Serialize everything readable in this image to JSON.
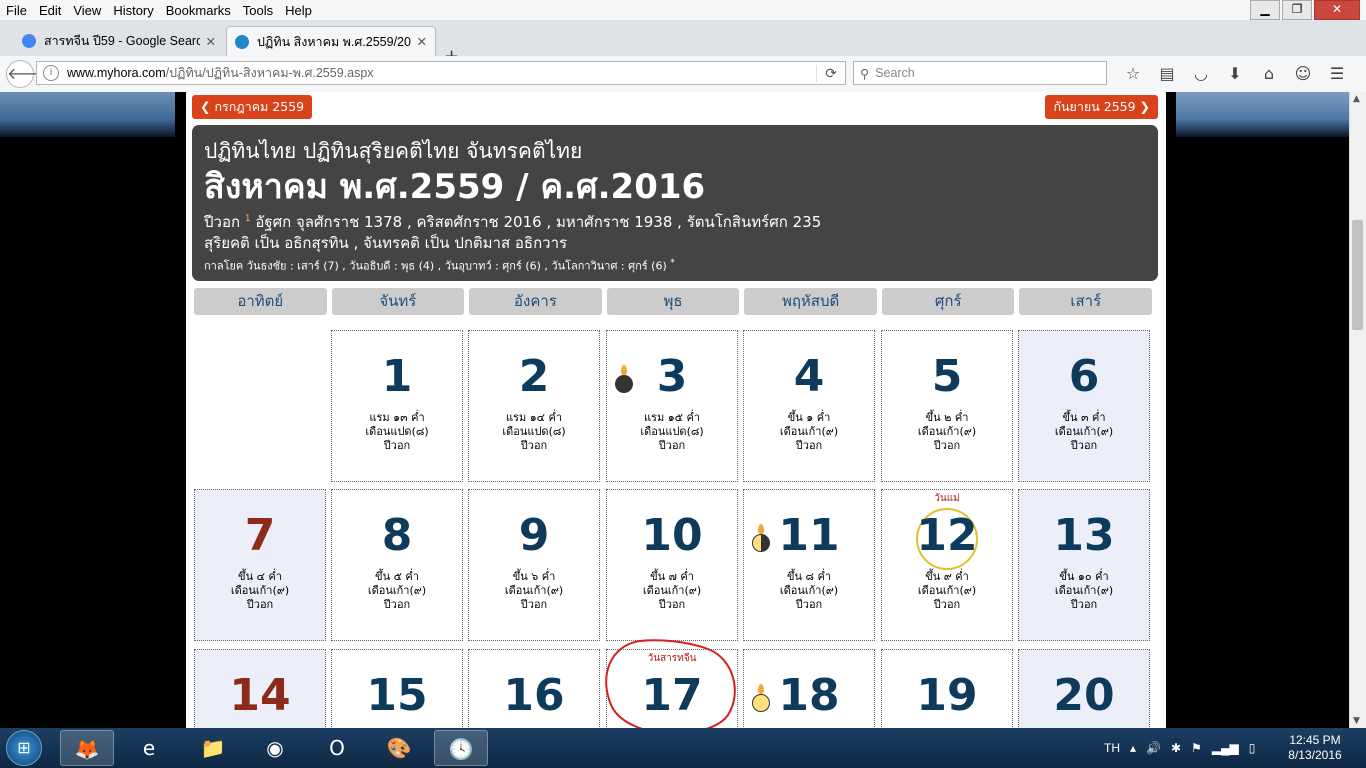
{
  "menubar": {
    "items": [
      "File",
      "Edit",
      "View",
      "History",
      "Bookmarks",
      "Tools",
      "Help"
    ]
  },
  "window": {
    "min": "▁",
    "max": "❐",
    "close": "✕"
  },
  "tabs": [
    {
      "title": "สารทจีน ปี59 - Google Search",
      "color": "#4285f4"
    },
    {
      "title": "ปฏิทิน สิงหาคม พ.ศ.2559/20...",
      "color": "#1e88c8"
    }
  ],
  "new_tab": "+",
  "nav": {
    "url_host": "www.myhora.com",
    "url_path": "/ปฏิทิน/ปฏิทิน-สิงหาคม-พ.ศ.2559.aspx",
    "search_placeholder": "Search"
  },
  "calendar": {
    "prev_month": "❮ กรกฎาคม 2559",
    "next_month": "กันยายน 2559 ❯",
    "title": "ปฏิทินไทย ปฏิทินสุริยคติไทย จันทรคติไทย",
    "month_year": "สิงหาคม พ.ศ.2559 / ค.ศ.2016",
    "era_prefix": "ปีวอก",
    "era_sup": "1",
    "era_text": "อัฐศก จุลศักราช 1378 , คริสตศักราช 2016 , มหาศักราช 1938 , รัตนโกสินทร์ศก 235",
    "solar_lunar": "สุริยคติ เป็น อธิกสุรทิน , จันทรคติ เป็น ปกติมาส อธิกวาร",
    "kala": "กาลโยค วันธงชัย : เสาร์ (7) , วันอธิบดี : พุธ (4) , วันอุบาทว์ : ศุกร์ (6) , วันโลกาวินาศ : ศุกร์ (6)",
    "kala_mark": "*",
    "weekdays": [
      "อาทิตย์",
      "จันทร์",
      "อังคาร",
      "พุธ",
      "พฤหัสบดี",
      "ศุกร์",
      "เสาร์"
    ],
    "days": [
      {
        "day": "1",
        "lunar1": "แรม ๑๓ ค่ำ",
        "lunar2": "เดือนแปด(๘)",
        "lunar3": "ปีวอก"
      },
      {
        "day": "2",
        "lunar1": "แรม ๑๔ ค่ำ",
        "lunar2": "เดือนแปด(๘)",
        "lunar3": "ปีวอก"
      },
      {
        "day": "3",
        "lunar1": "แรม ๑๕ ค่ำ",
        "lunar2": "เดือนแปด(๘)",
        "lunar3": "ปีวอก",
        "moon": "new"
      },
      {
        "day": "4",
        "lunar1": "ขึ้น ๑ ค่ำ",
        "lunar2": "เดือนเก้า(๙)",
        "lunar3": "ปีวอก"
      },
      {
        "day": "5",
        "lunar1": "ขึ้น ๒ ค่ำ",
        "lunar2": "เดือนเก้า(๙)",
        "lunar3": "ปีวอก"
      },
      {
        "day": "6",
        "lunar1": "ขึ้น ๓ ค่ำ",
        "lunar2": "เดือนเก้า(๙)",
        "lunar3": "ปีวอก"
      },
      {
        "day": "7",
        "lunar1": "ขึ้น ๔ ค่ำ",
        "lunar2": "เดือนเก้า(๙)",
        "lunar3": "ปีวอก"
      },
      {
        "day": "8",
        "lunar1": "ขึ้น ๕ ค่ำ",
        "lunar2": "เดือนเก้า(๙)",
        "lunar3": "ปีวอก"
      },
      {
        "day": "9",
        "lunar1": "ขึ้น ๖ ค่ำ",
        "lunar2": "เดือนเก้า(๙)",
        "lunar3": "ปีวอก"
      },
      {
        "day": "10",
        "lunar1": "ขึ้น ๗ ค่ำ",
        "lunar2": "เดือนเก้า(๙)",
        "lunar3": "ปีวอก"
      },
      {
        "day": "11",
        "lunar1": "ขึ้น ๘ ค่ำ",
        "lunar2": "เดือนเก้า(๙)",
        "lunar3": "ปีวอก",
        "moon": "half"
      },
      {
        "day": "12",
        "lunar1": "ขึ้น ๙ ค่ำ",
        "lunar2": "เดือนเก้า(๙)",
        "lunar3": "ปีวอก",
        "note": "วันแม่",
        "today": true
      },
      {
        "day": "13",
        "lunar1": "ขึ้น ๑๐ ค่ำ",
        "lunar2": "เดือนเก้า(๙)",
        "lunar3": "ปีวอก"
      },
      {
        "day": "14"
      },
      {
        "day": "15"
      },
      {
        "day": "16"
      },
      {
        "day": "17",
        "note": "วันสารทจีน"
      },
      {
        "day": "18",
        "moon": "full"
      },
      {
        "day": "19"
      },
      {
        "day": "20"
      }
    ]
  },
  "taskbar": {
    "items": [
      {
        "icon": "firefox-icon",
        "glyph": "🦊",
        "active": true
      },
      {
        "icon": "ie-icon",
        "glyph": "e"
      },
      {
        "icon": "explorer-icon",
        "glyph": "📁"
      },
      {
        "icon": "chrome-icon",
        "glyph": "◉"
      },
      {
        "icon": "opera-icon",
        "glyph": "O"
      },
      {
        "icon": "paint-icon",
        "glyph": "🎨"
      },
      {
        "icon": "clock-app-icon",
        "glyph": "🕓",
        "active": true
      }
    ],
    "lang": "TH",
    "time": "12:45 PM",
    "date": "8/13/2016"
  }
}
